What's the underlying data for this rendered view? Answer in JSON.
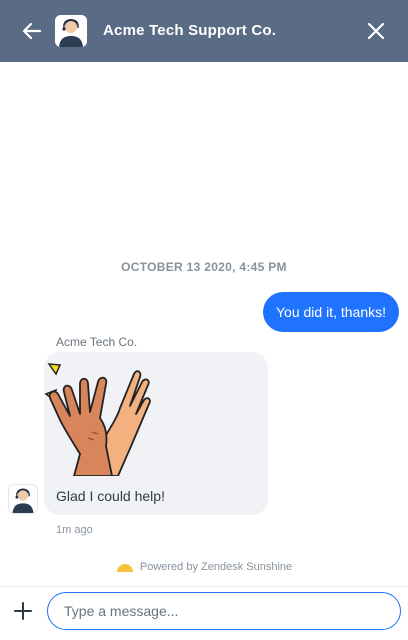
{
  "header": {
    "title": "Acme Tech Support Co.",
    "back_icon": "arrow-left-icon",
    "close_icon": "close-icon",
    "background": "#5a6b85"
  },
  "conversation": {
    "date_divider": "OCTOBER 13 2020, 4:45 PM",
    "messages": [
      {
        "sender": "user",
        "text": "You did it, thanks!",
        "color": "#1f73ff"
      },
      {
        "sender": "agent",
        "name": "Acme Tech Co.",
        "sticker": "high-five-sticker",
        "text": "Glad I could help!",
        "time": "1m ago"
      }
    ]
  },
  "footer": {
    "powered_by": "Powered by Zendesk Sunshine",
    "input_placeholder": "Type a message...",
    "input_value": ""
  }
}
